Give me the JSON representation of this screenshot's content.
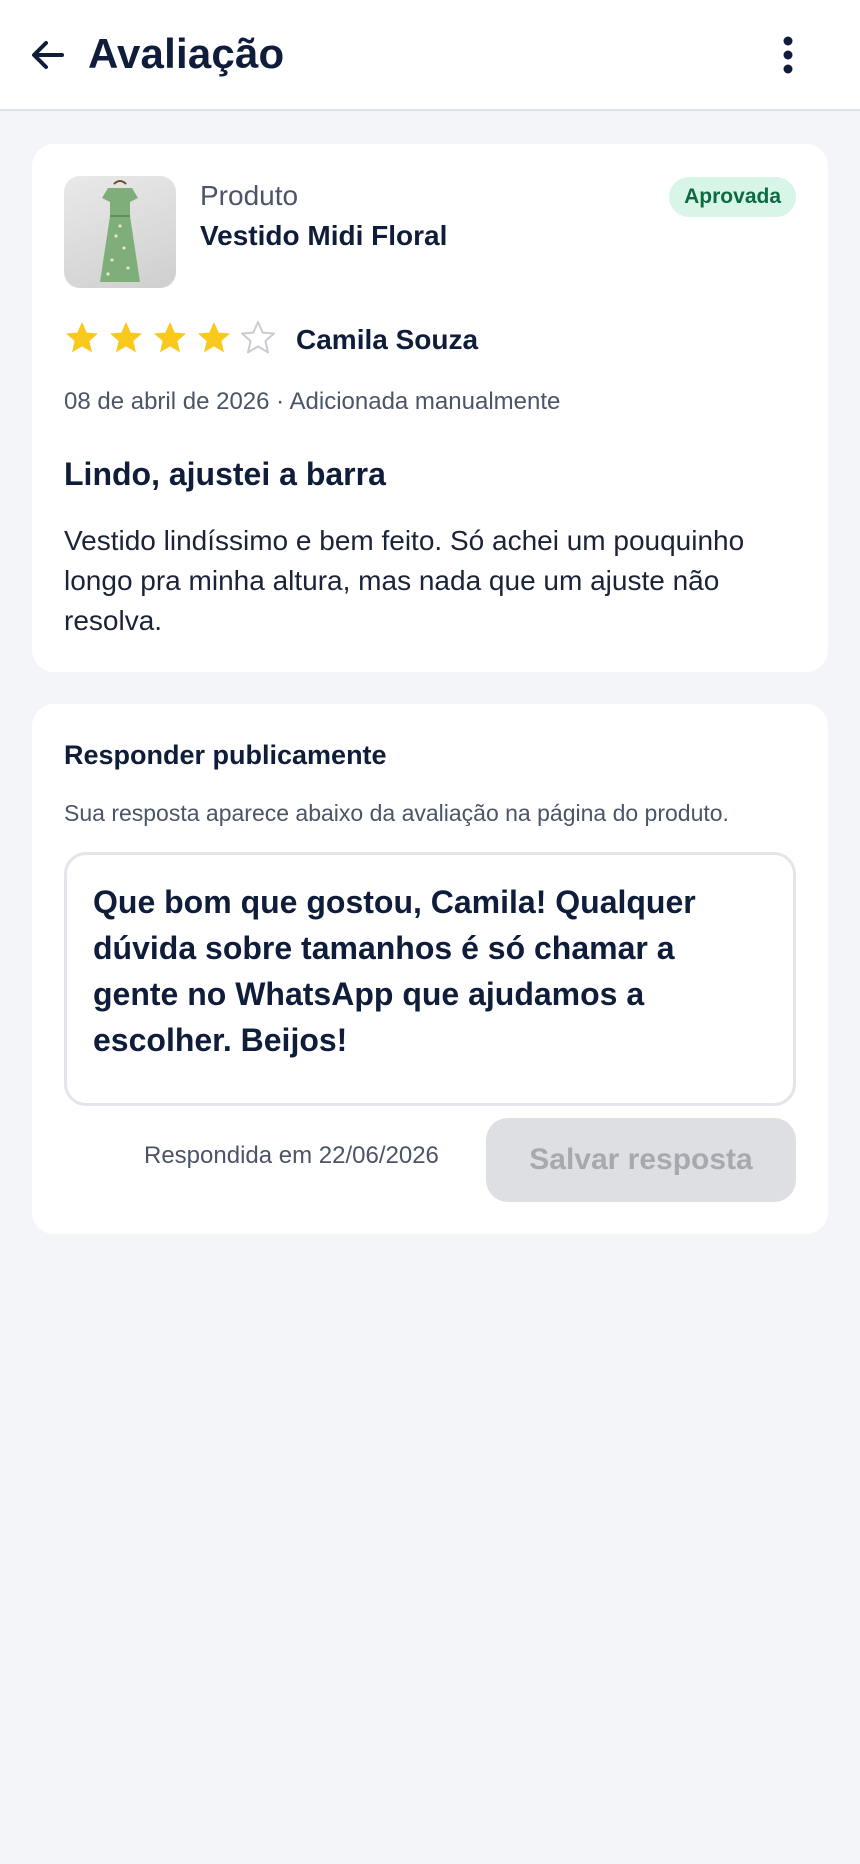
{
  "header": {
    "title": "Avaliação",
    "back_icon": "arrow-left-icon",
    "more_icon": "more-vertical-icon"
  },
  "review": {
    "product_label": "Produto",
    "product_name": "Vestido Midi Floral",
    "status": "Aprovada",
    "rating": 4,
    "rating_max": 5,
    "author": "Camila Souza",
    "meta": "08 de abril de 2026 · Adicionada manualmente",
    "title": "Lindo, ajustei a barra",
    "body": "Vestido lindíssimo e bem feito. Só achei um pouquinho longo pra minha altura, mas nada que um ajuste não resolva."
  },
  "reply": {
    "heading": "Responder publicamente",
    "help": "Sua resposta aparece abaixo da avaliação na página do produto.",
    "text": "Que bom que gostou, Camila! Qualquer dúvida sobre tamanhos é só chamar a gente no WhatsApp que ajudamos a escolher. Beijos!",
    "answered_at": "Respondida em 22/06/2026",
    "save_label": "Salvar resposta"
  },
  "colors": {
    "star_filled": "#f9c81c",
    "star_empty": "#c9ccd3",
    "badge_bg": "#d7f6e7",
    "badge_text": "#0e6a3f",
    "text_primary": "#0f1d3a"
  }
}
